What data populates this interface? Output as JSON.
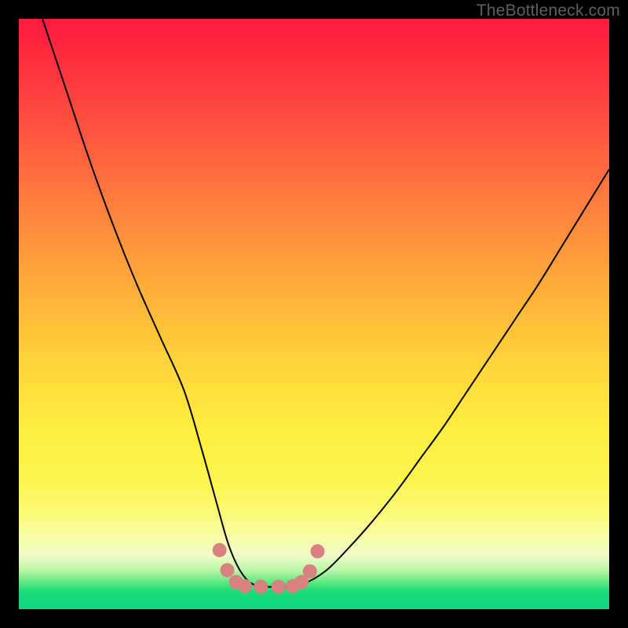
{
  "watermark": {
    "text": "TheBottleneck.com"
  },
  "colors": {
    "background": "#000000",
    "curve": "#000000",
    "marker_fill": "#d98080",
    "marker_stroke": "#b45a5a"
  },
  "chart_data": {
    "type": "line",
    "title": "",
    "xlabel": "",
    "ylabel": "",
    "xlim": [
      0,
      100
    ],
    "ylim": [
      0,
      100
    ],
    "grid": false,
    "series": [
      {
        "name": "curve",
        "x": [
          4,
          8,
          12,
          16,
          20,
          24,
          28,
          31,
          33.5,
          35.5,
          37.5,
          39.5,
          42,
          45,
          48,
          52,
          56,
          60,
          64,
          68,
          72,
          76,
          80,
          84,
          88,
          92,
          96,
          100
        ],
        "y": [
          100,
          88,
          76,
          65,
          55,
          46,
          37,
          27,
          18,
          11,
          6.5,
          4.3,
          3.8,
          3.8,
          4.2,
          6.5,
          10.5,
          15,
          20,
          25.5,
          31,
          37,
          43,
          49,
          55,
          61.5,
          68,
          74.5
        ]
      }
    ],
    "markers": [
      {
        "x": 34.0,
        "y": 10.0
      },
      {
        "x": 35.3,
        "y": 6.6
      },
      {
        "x": 36.8,
        "y": 4.6
      },
      {
        "x": 38.3,
        "y": 3.9
      },
      {
        "x": 41.0,
        "y": 3.8
      },
      {
        "x": 44.0,
        "y": 3.8
      },
      {
        "x": 46.4,
        "y": 3.9
      },
      {
        "x": 47.9,
        "y": 4.6
      },
      {
        "x": 49.3,
        "y": 6.4
      },
      {
        "x": 50.6,
        "y": 9.8
      }
    ]
  }
}
